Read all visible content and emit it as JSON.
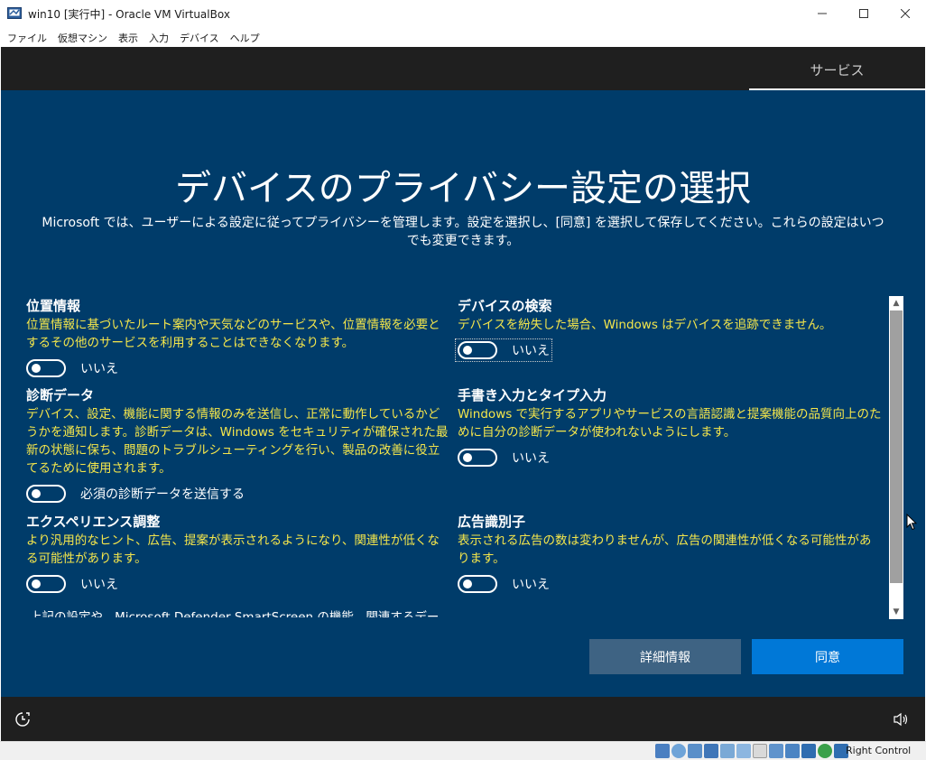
{
  "window": {
    "title": "win10 [実行中] - Oracle VM VirtualBox"
  },
  "menu": [
    "ファイル",
    "仮想マシン",
    "表示",
    "入力",
    "デバイス",
    "ヘルプ"
  ],
  "oobe": {
    "tab_label": "サービス",
    "title": "デバイスのプライバシー設定の選択",
    "description": "Microsoft では、ユーザーによる設定に従ってプライバシーを管理します。設定を選択し、[同意] を選択して保存してください。これらの設定はいつでも変更できます。",
    "settings": [
      {
        "title": "位置情報",
        "desc": "位置情報に基づいたルート案内や天気などのサービスや、位置情報を必要とするその他のサービスを利用することはできなくなります。",
        "toggle_label": "いいえ",
        "on": false
      },
      {
        "title": "デバイスの検索",
        "desc": "デバイスを紛失した場合、Windows はデバイスを追跡できません。",
        "toggle_label": "いいえ",
        "on": false
      },
      {
        "title": "診断データ",
        "desc": "デバイス、設定、機能に関する情報のみを送信し、正常に動作しているかどうかを通知します。診断データは、Windows をセキュリティが確保された最新の状態に保ち、問題のトラブルシューティングを行い、製品の改善に役立てるために使用されます。",
        "toggle_label": "必須の診断データを送信する",
        "on": false
      },
      {
        "title": "手書き入力とタイプ入力",
        "desc": "Windows で実行するアプリやサービスの言語認識と提案機能の品質向上のために自分の診断データが使われないようにします。",
        "toggle_label": "いいえ",
        "on": false
      },
      {
        "title": "エクスペリエンス調整",
        "desc": "より汎用的なヒント、広告、提案が表示されるようになり、関連性が低くなる可能性があります。",
        "toggle_label": "いいえ",
        "on": false
      },
      {
        "title": "広告識別子",
        "desc": "表示される広告の数は変わりませんが、広告の関連性が低くなる可能性があります。",
        "toggle_label": "いいえ",
        "on": false
      }
    ],
    "footnote": "上記の設定や、Microsoft Defender SmartScreen の機能、関連するデー",
    "more_button": "詳細情報",
    "accept_button": "同意"
  },
  "statusbar": {
    "host_key": "Right Control"
  },
  "colors": {
    "background": "#003c6a",
    "description_text": "#f5e64b",
    "accept_button": "#0078d7",
    "more_button": "#3e6383"
  }
}
